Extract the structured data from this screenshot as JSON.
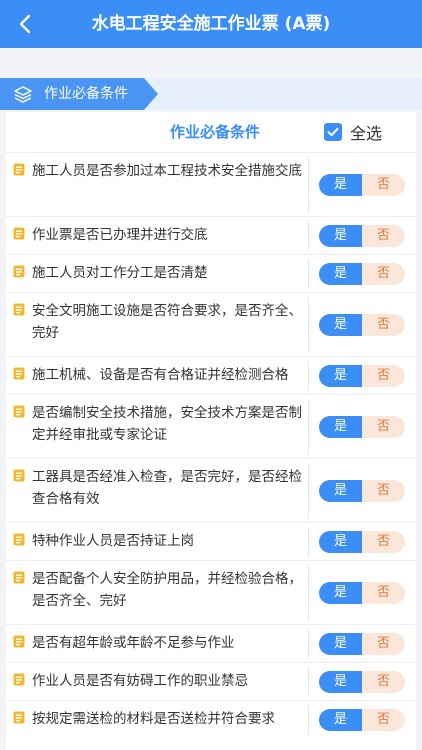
{
  "header": {
    "title": "水电工程安全施工作业票 (A票)"
  },
  "section": {
    "label": "作业必备条件"
  },
  "card": {
    "column_title": "作业必备条件",
    "select_all_label": "全选",
    "select_all_checked": true
  },
  "options": {
    "yes": "是",
    "no": "否"
  },
  "colors": {
    "primary": "#3a8ef6",
    "no_bg": "#fbe6da",
    "no_text": "#e87b3c",
    "item_icon": "#f3b832"
  },
  "items": [
    {
      "text": "施工人员是否参加过本工程技术安全措施交底",
      "selected": "是"
    },
    {
      "text": "作业票是否已办理并进行交底",
      "selected": "是"
    },
    {
      "text": "施工人员对工作分工是否清楚",
      "selected": "是"
    },
    {
      "text": "安全文明施工设施是否符合要求，是否齐全、完好",
      "selected": "是"
    },
    {
      "text": "施工机械、设备是否有合格证并经检测合格",
      "selected": "是"
    },
    {
      "text": "是否编制安全技术措施，安全技术方案是否制定并经审批或专家论证",
      "selected": "是"
    },
    {
      "text": "工器具是否经准入检查，是否完好，是否经检查合格有效",
      "selected": "是"
    },
    {
      "text": "特种作业人员是否持证上岗",
      "selected": "是"
    },
    {
      "text": "是否配备个人安全防护用品，并经检验合格，是否齐全、完好",
      "selected": "是"
    },
    {
      "text": "是否有超年龄或年龄不足参与作业",
      "selected": "是"
    },
    {
      "text": "作业人员是否有妨碍工作的职业禁忌",
      "selected": "是"
    },
    {
      "text": "按规定需送检的材料是否送检并符合要求",
      "selected": "是"
    }
  ]
}
